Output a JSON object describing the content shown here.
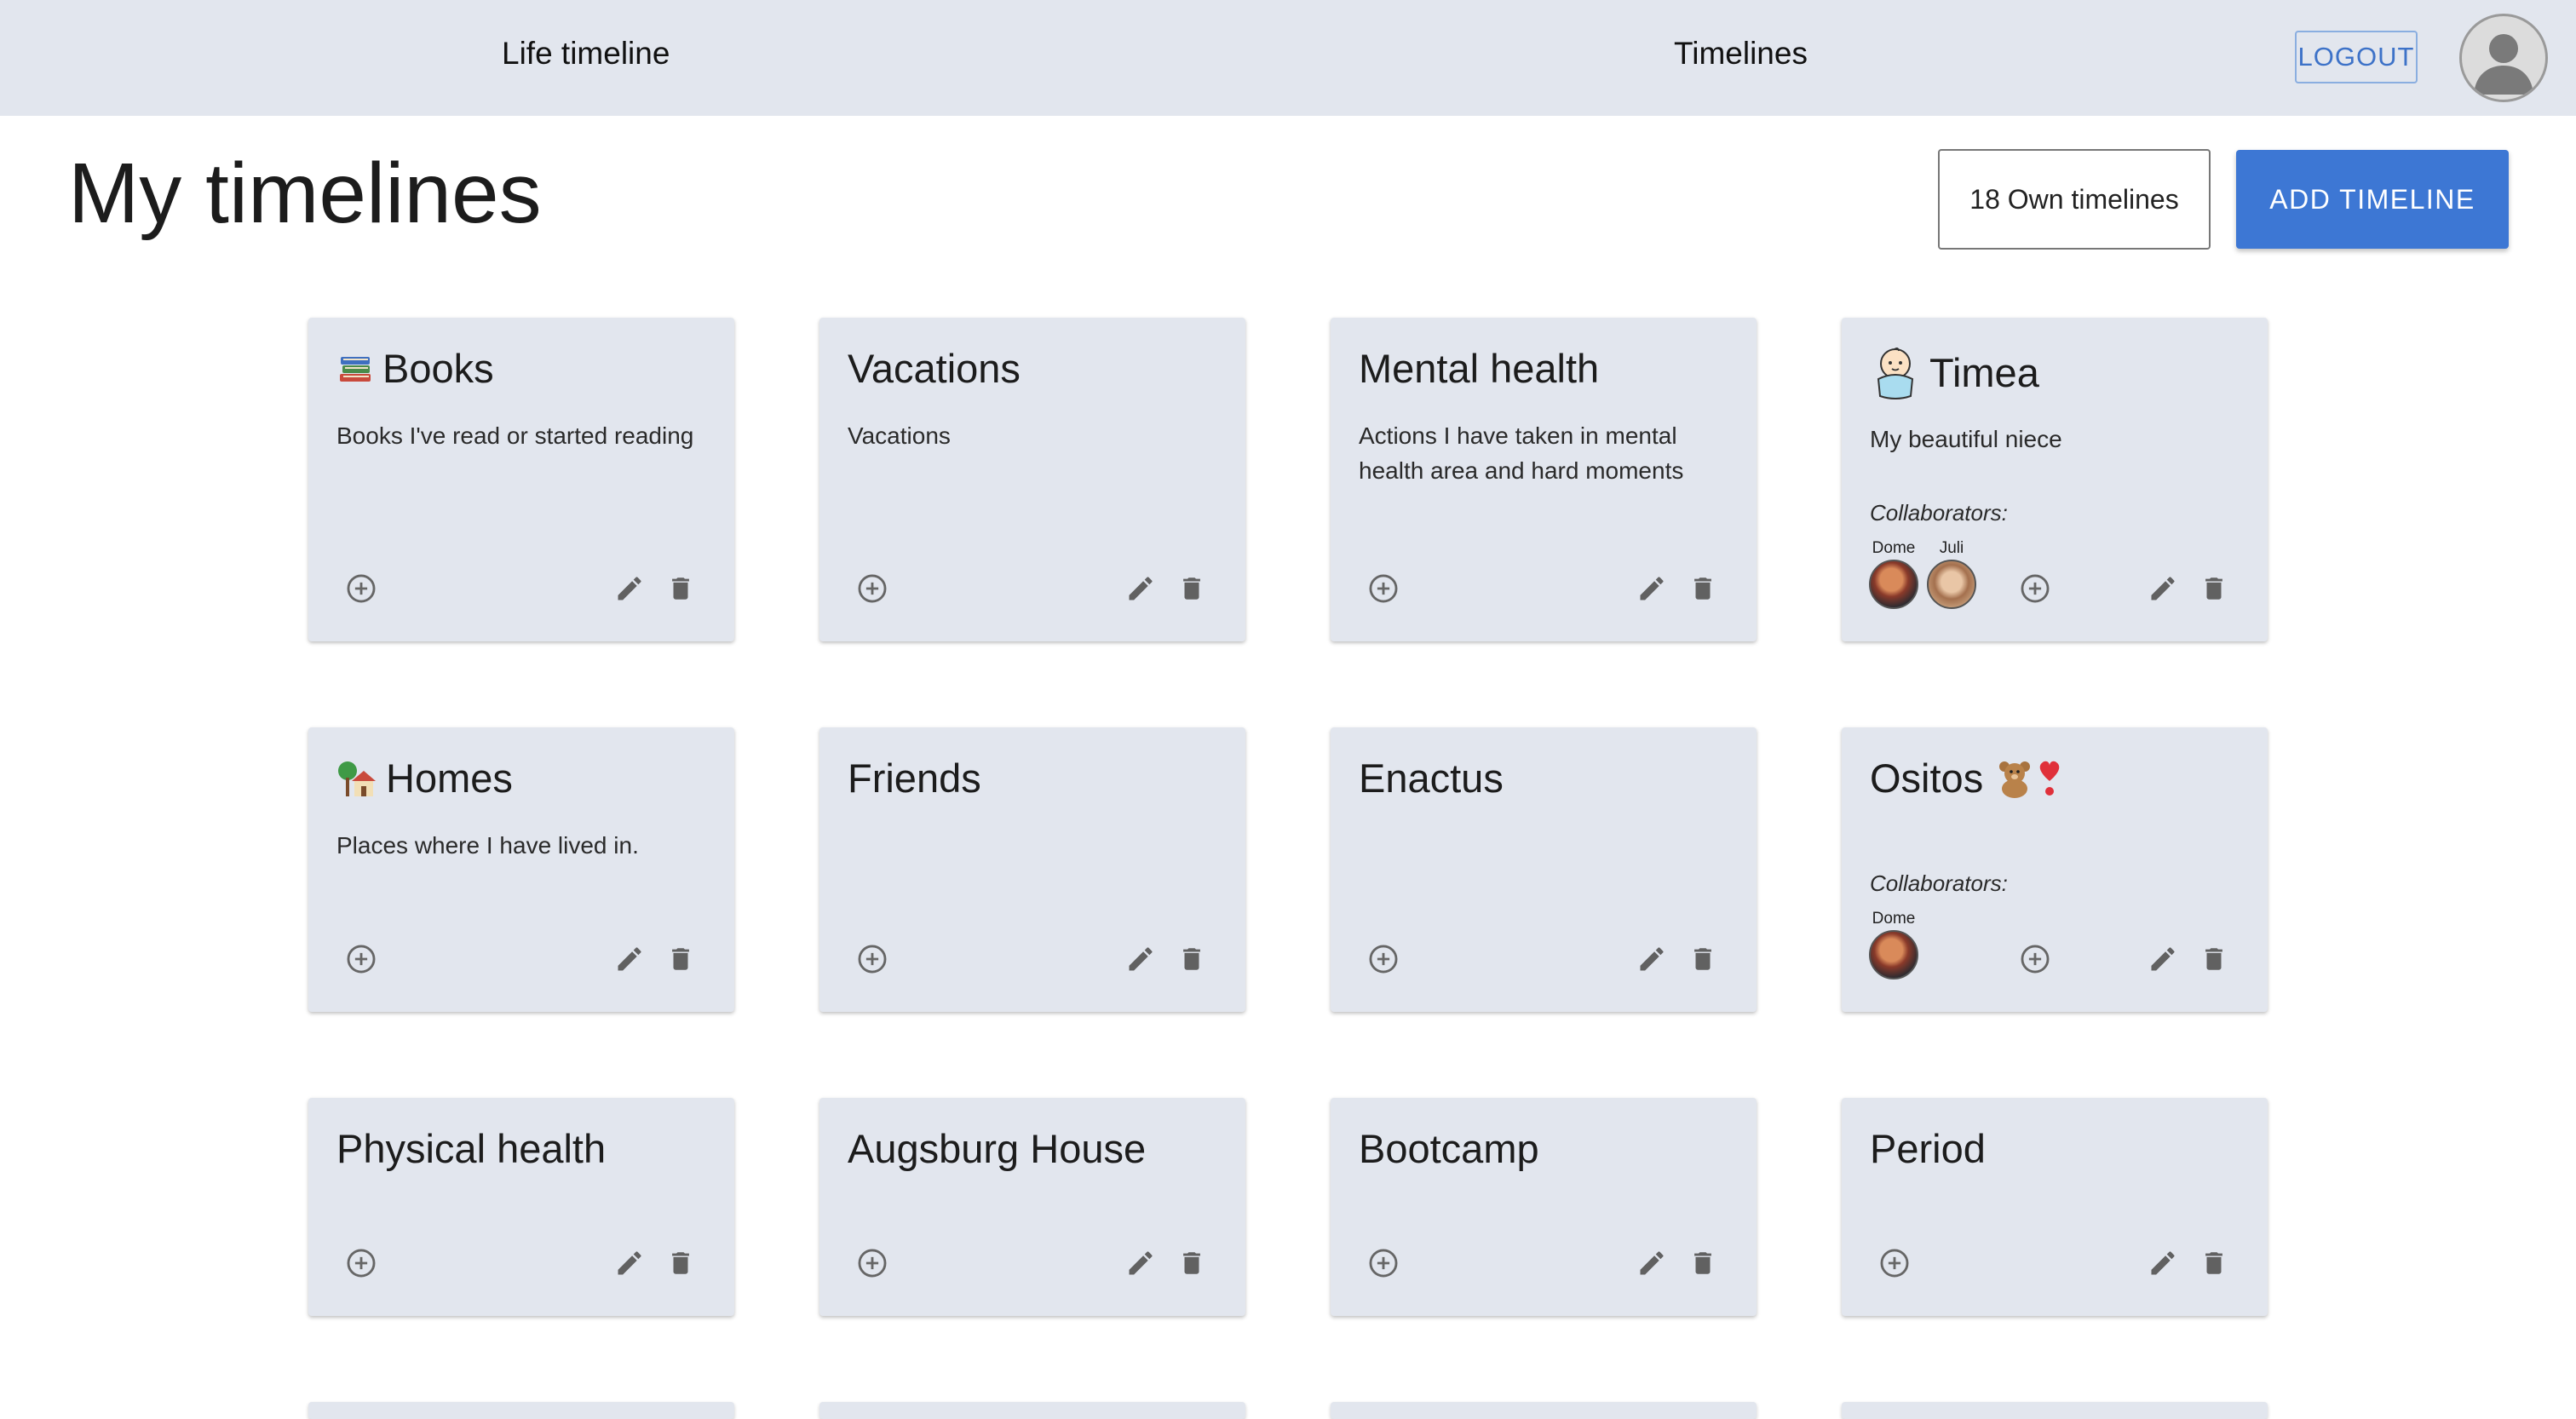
{
  "nav": {
    "life_timeline": "Life timeline",
    "timelines": "Timelines",
    "logout": "LOGOUT"
  },
  "page": {
    "title": "My timelines",
    "own_count": "18 Own timelines",
    "add_button": "ADD TIMELINE"
  },
  "colors": {
    "appbar": "#e2e6ee",
    "card": "#e2e6ee",
    "primary": "#3d77d4"
  },
  "cards": [
    {
      "title": "Books",
      "emoji": "books-icon",
      "description": "Books I've read or started reading"
    },
    {
      "title": "Vacations",
      "description": "Vacations"
    },
    {
      "title": "Mental health",
      "description": "Actions I have taken in mental health area and hard moments"
    },
    {
      "title": "Timea",
      "emoji": "baby-icon",
      "description": "My beautiful niece",
      "collaborators_label": "Collaborators:",
      "collaborators": [
        "Dome",
        "Juli"
      ]
    },
    {
      "title": "Homes",
      "emoji": "house-icon",
      "description": "Places where I have lived in."
    },
    {
      "title": "Friends",
      "description": ""
    },
    {
      "title": "Enactus",
      "description": ""
    },
    {
      "title": "Ositos",
      "emoji_after": [
        "teddy-bear-icon",
        "heart-exclamation-icon"
      ],
      "description": "",
      "collaborators_label": "Collaborators:",
      "collaborators": [
        "Dome"
      ]
    },
    {
      "title": "Physical health",
      "description": ""
    },
    {
      "title": "Augsburg House",
      "description": ""
    },
    {
      "title": "Bootcamp",
      "description": ""
    },
    {
      "title": "Period",
      "description": ""
    }
  ]
}
